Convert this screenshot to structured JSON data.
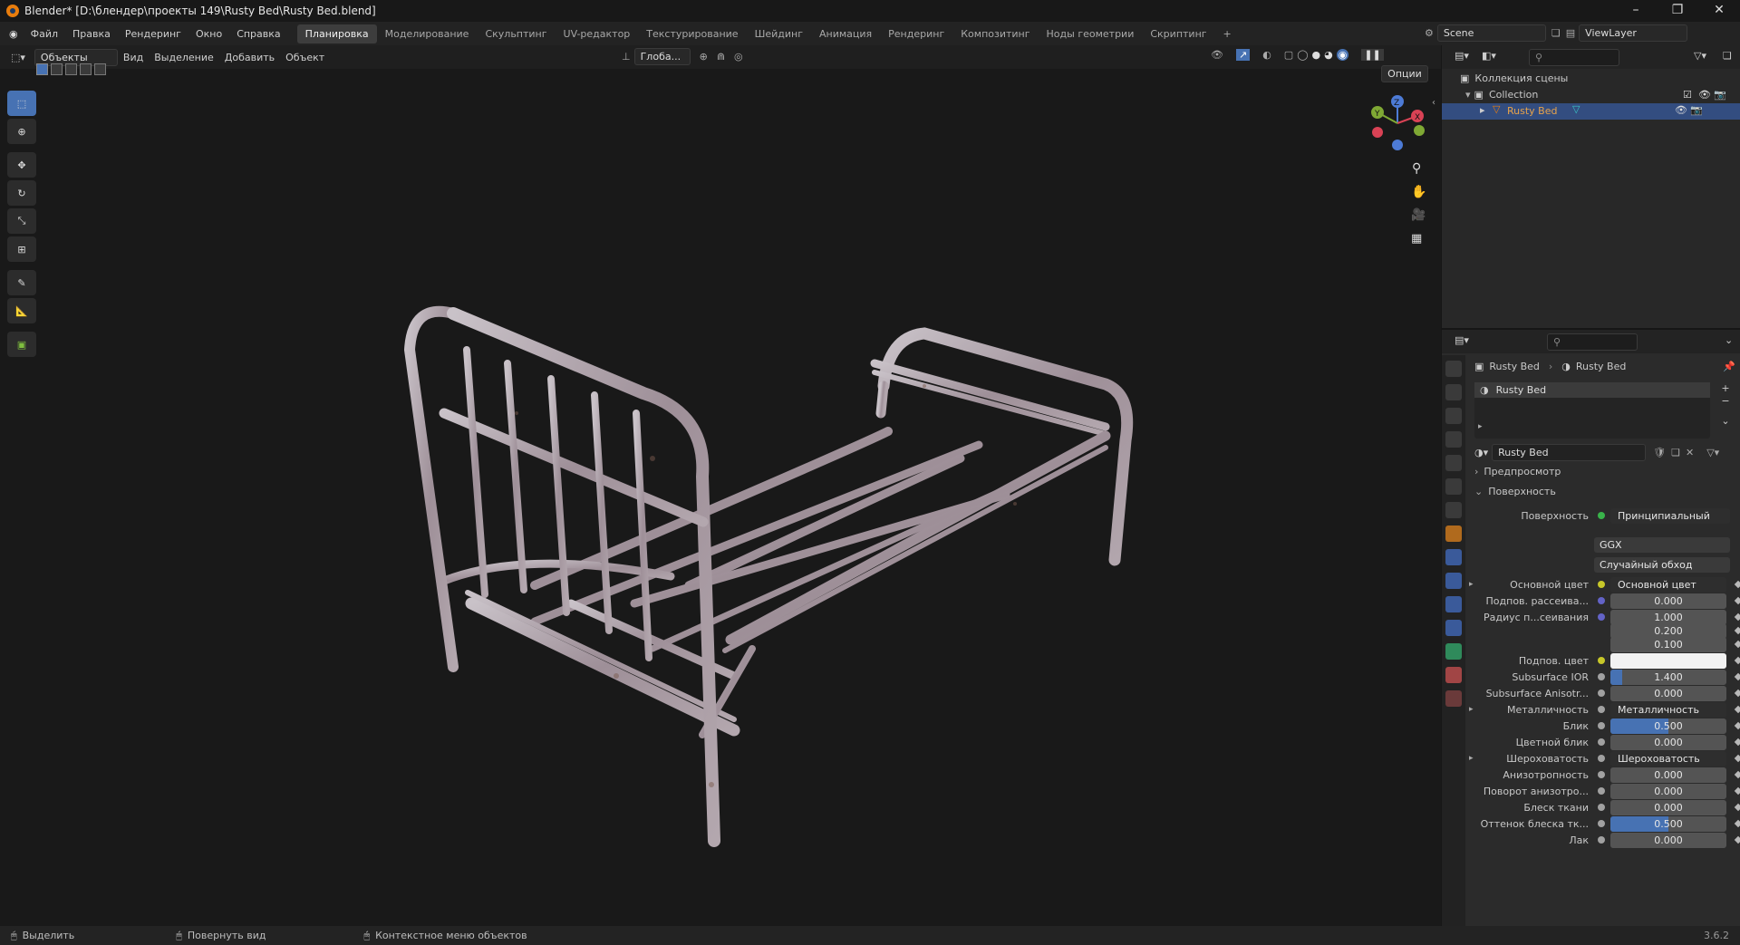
{
  "window": {
    "title": "Blender* [D:\\блендер\\проекты 149\\Rusty Bed\\Rusty Bed.blend]"
  },
  "menu": [
    "Файл",
    "Правка",
    "Рендеринг",
    "Окно",
    "Справка"
  ],
  "workspaces": [
    "Планировка",
    "Моделирование",
    "Скульптинг",
    "UV-редактор",
    "Текстурирование",
    "Шейдинг",
    "Анимация",
    "Рендеринг",
    "Композитинг",
    "Ноды геометрии",
    "Скриптинг",
    "+"
  ],
  "active_workspace": "Планировка",
  "scene": "Scene",
  "view_layer": "ViewLayer",
  "viewport_header": {
    "mode": "Объекты",
    "menus": [
      "Вид",
      "Выделение",
      "Добавить",
      "Объект"
    ],
    "orientation": "Глоба...",
    "options": "Опции"
  },
  "outliner": {
    "root": "Коллекция сцены",
    "collection": "Collection",
    "object": "Rusty Bed"
  },
  "properties": {
    "breadcrumb_object": "Rusty Bed",
    "breadcrumb_material": "Rusty Bed",
    "slot": "Rusty Bed",
    "material_name": "Rusty Bed",
    "panels": {
      "preview": "Предпросмотр",
      "surface": "Поверхность"
    },
    "surface_label": "Поверхность",
    "surface_value": "Принципиальный BSDF",
    "distribution": "GGX",
    "subsurface_method": "Случайный обход",
    "rows": [
      {
        "label": "Основной цвет",
        "value": "Основной цвет",
        "kind": "link",
        "dot": "#c7c729",
        "expand": true
      },
      {
        "label": "Подпов. рассеива...",
        "value": "0.000",
        "kind": "num",
        "dot": "#6363c7"
      },
      {
        "label": "Радиус п...сеивания",
        "value": "1.000",
        "kind": "num",
        "dot": "#6363c7"
      },
      {
        "label": "",
        "value": "0.200",
        "kind": "num",
        "dot": ""
      },
      {
        "label": "",
        "value": "0.100",
        "kind": "num",
        "dot": ""
      },
      {
        "label": "Подпов. цвет",
        "value": "",
        "kind": "color",
        "dot": "#c7c729"
      },
      {
        "label": "Subsurface IOR",
        "value": "1.400",
        "kind": "num",
        "dot": "#a1a1a1",
        "fill": 0.1
      },
      {
        "label": "Subsurface Anisotr...",
        "value": "0.000",
        "kind": "num",
        "dot": "#a1a1a1"
      },
      {
        "label": "Металличность",
        "value": "Металличность",
        "kind": "link",
        "dot": "#a1a1a1",
        "expand": true
      },
      {
        "label": "Блик",
        "value": "0.500",
        "kind": "num",
        "dot": "#a1a1a1",
        "fill": 0.5
      },
      {
        "label": "Цветной блик",
        "value": "0.000",
        "kind": "num",
        "dot": "#a1a1a1"
      },
      {
        "label": "Шероховатость",
        "value": "Шероховатость",
        "kind": "link",
        "dot": "#a1a1a1",
        "expand": true
      },
      {
        "label": "Анизотропность",
        "value": "0.000",
        "kind": "num",
        "dot": "#a1a1a1"
      },
      {
        "label": "Поворот анизотро...",
        "value": "0.000",
        "kind": "num",
        "dot": "#a1a1a1"
      },
      {
        "label": "Блеск ткани",
        "value": "0.000",
        "kind": "num",
        "dot": "#a1a1a1"
      },
      {
        "label": "Оттенок блеска тк...",
        "value": "0.500",
        "kind": "num",
        "dot": "#a1a1a1",
        "fill": 0.5
      },
      {
        "label": "Лак",
        "value": "0.000",
        "kind": "num",
        "dot": "#a1a1a1"
      }
    ]
  },
  "statusbar": {
    "select": "Выделить",
    "rotate": "Повернуть вид",
    "context": "Контекстное меню объектов",
    "version": "3.6.2"
  },
  "colors": {
    "accent": "#4772b3",
    "selected_row": "#334d80",
    "object_orange": "#e87d0d"
  }
}
